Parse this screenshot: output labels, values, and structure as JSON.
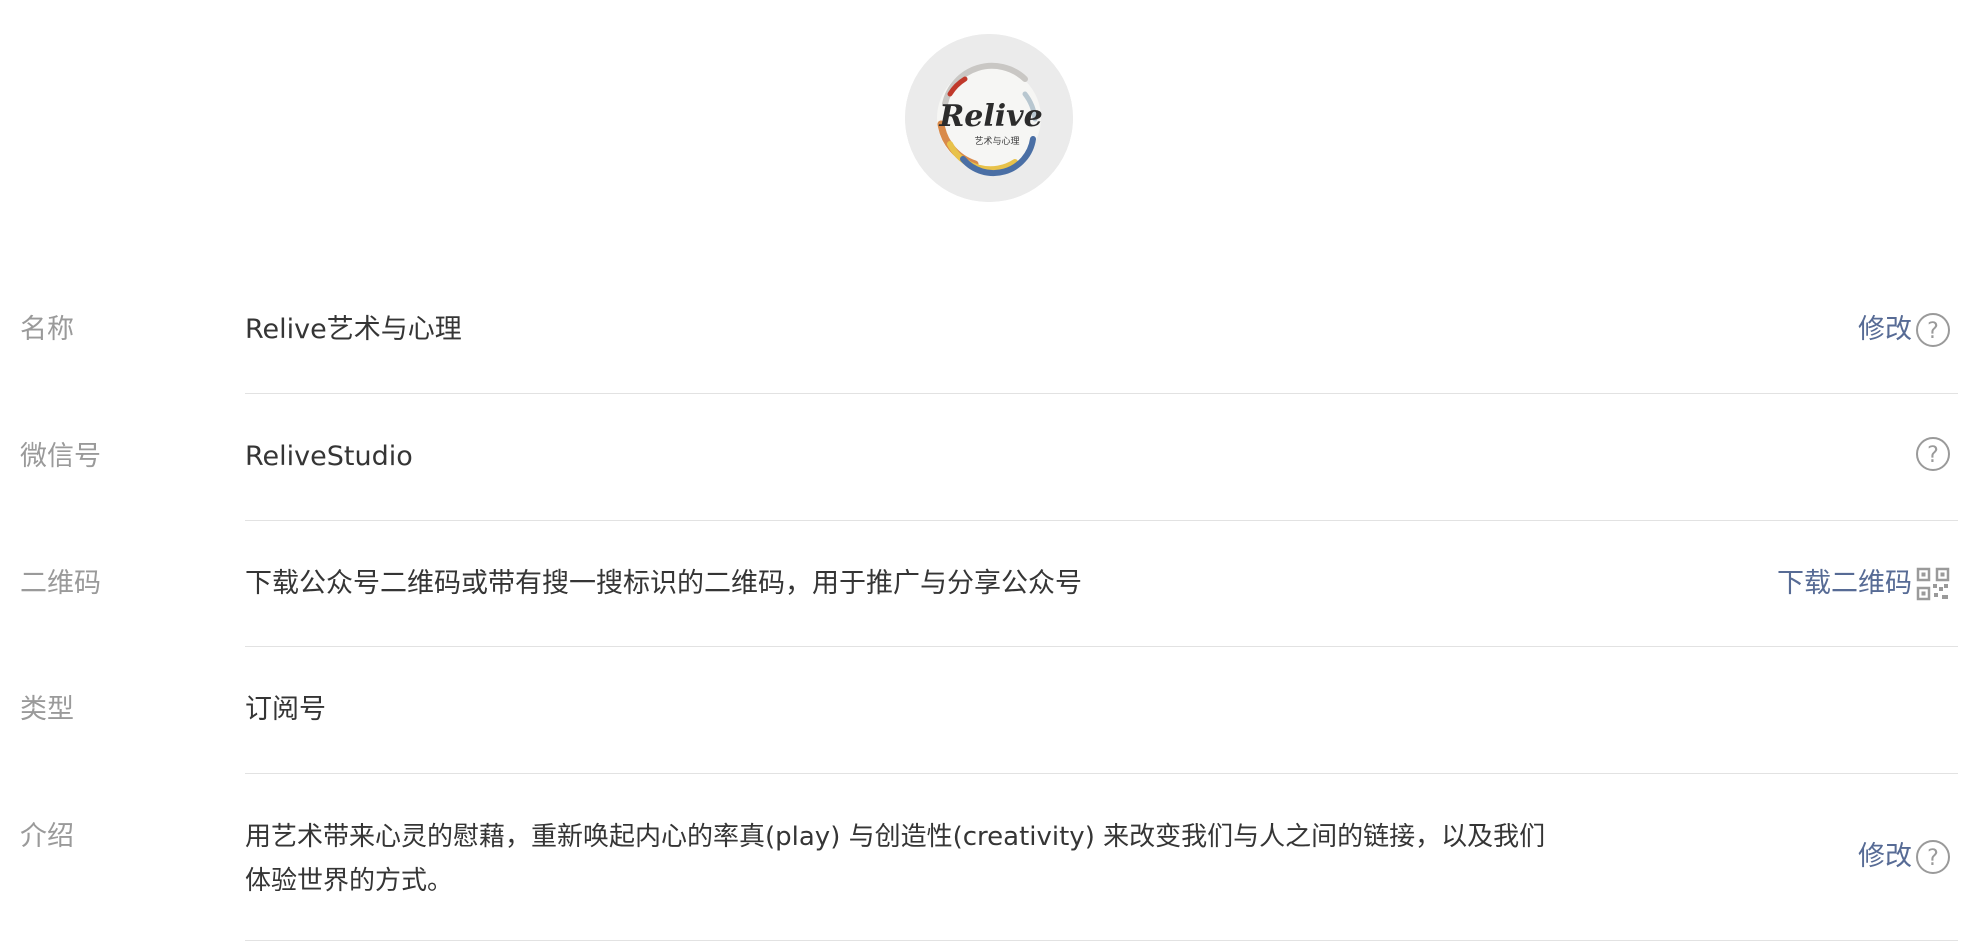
{
  "avatar": {
    "logo_text": "Relive",
    "logo_subtext": "艺术与心理"
  },
  "colors": {
    "link": "#576b95",
    "label": "#9a9a9a",
    "text": "#353535",
    "divider": "#e2e2e2"
  },
  "rows": {
    "name": {
      "label": "名称",
      "value": "Relive艺术与心理",
      "action": "修改",
      "icon": "help-icon"
    },
    "wechat_id": {
      "label": "微信号",
      "value": "ReliveStudio",
      "icon": "help-icon"
    },
    "qrcode": {
      "label": "二维码",
      "value": "下载公众号二维码或带有搜一搜标识的二维码，用于推广与分享公众号",
      "action": "下载二维码",
      "icon": "qr-code-icon"
    },
    "type": {
      "label": "类型",
      "value": "订阅号"
    },
    "intro": {
      "label": "介绍",
      "value_line1": "用艺术带来心灵的慰藉，重新唤起内心的率真(play) 与创造性(creativity) 来改变我们与人之间的链接，以及我们",
      "value_line2": "体验世界的方式。",
      "action": "修改",
      "icon": "help-icon"
    }
  }
}
